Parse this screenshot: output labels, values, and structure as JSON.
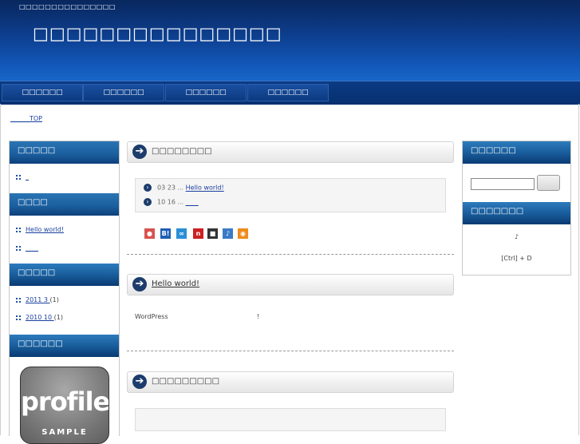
{
  "header": {
    "tagline": "□□□□□□□□□□□□□□□",
    "title": "□□□□□□□□□□□□□□□"
  },
  "nav": {
    "items": [
      "□□□□□□",
      "□□□□□□",
      "□□□□□□",
      "□□□□□□"
    ]
  },
  "breadcrumb": "______TOP",
  "sidebar_left": {
    "category_title": "□□□□□",
    "category_items": [
      {
        "label": "_"
      }
    ],
    "recent_title": "□□□□",
    "recent_items": [
      {
        "label": "Hello world!"
      },
      {
        "label": "____"
      }
    ],
    "archive_title": "□□□□□",
    "archive_items": [
      {
        "label": "2011 3 ",
        "count": "(1)"
      },
      {
        "label": "2010 10 ",
        "count": "(1)"
      }
    ],
    "profile_title": "□□□□□□",
    "profile_image_text": "profile",
    "profile_image_subtext": "SAMPLE"
  },
  "main": {
    "section1_title": "□□□□□□□□",
    "recent_posts": [
      {
        "date": "03 23",
        "sep": " ... ",
        "title": "Hello world!"
      },
      {
        "date": "10 16",
        "sep": " ... ",
        "title": "____"
      }
    ],
    "post_title": "Hello world!",
    "post_text": "WordPress",
    "post_excl": "!",
    "section3_title": "□□□□□□□□□"
  },
  "social_icons": [
    {
      "name": "bookmark-icon",
      "glyph": "●",
      "color": "#d9534f"
    },
    {
      "name": "hatena-icon",
      "glyph": "B!",
      "color": "#1d5fb4"
    },
    {
      "name": "link-icon",
      "glyph": "∞",
      "color": "#2a8fd6"
    },
    {
      "name": "buzzurl-icon",
      "glyph": "n",
      "color": "#cc2020"
    },
    {
      "name": "delicious-icon",
      "glyph": "■",
      "color": "#333333"
    },
    {
      "name": "livedoor-icon",
      "glyph": "♪",
      "color": "#3a7bc8"
    },
    {
      "name": "rss-icon",
      "glyph": "◉",
      "color": "#f08a1c"
    }
  ],
  "sidebar_right": {
    "search_title": "□□□□□□",
    "search_value": "",
    "bookmark_title": "□□□□□□□",
    "bookmark_note": "♪",
    "bookmark_shortcut": "[Ctrl] + D"
  }
}
